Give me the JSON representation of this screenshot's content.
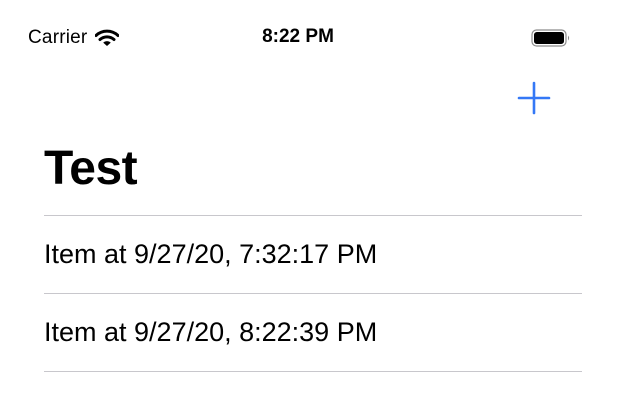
{
  "status_bar": {
    "carrier": "Carrier",
    "time": "8:22 PM",
    "wifi_icon": "wifi-icon",
    "battery_icon": "battery-full-icon"
  },
  "nav": {
    "add_icon": "plus-icon",
    "accent_color": "#3478f6",
    "title": "Test"
  },
  "list": {
    "items": [
      {
        "label": "Item at 9/27/20, 7:32:17 PM"
      },
      {
        "label": "Item at 9/27/20, 8:22:39 PM"
      }
    ]
  }
}
